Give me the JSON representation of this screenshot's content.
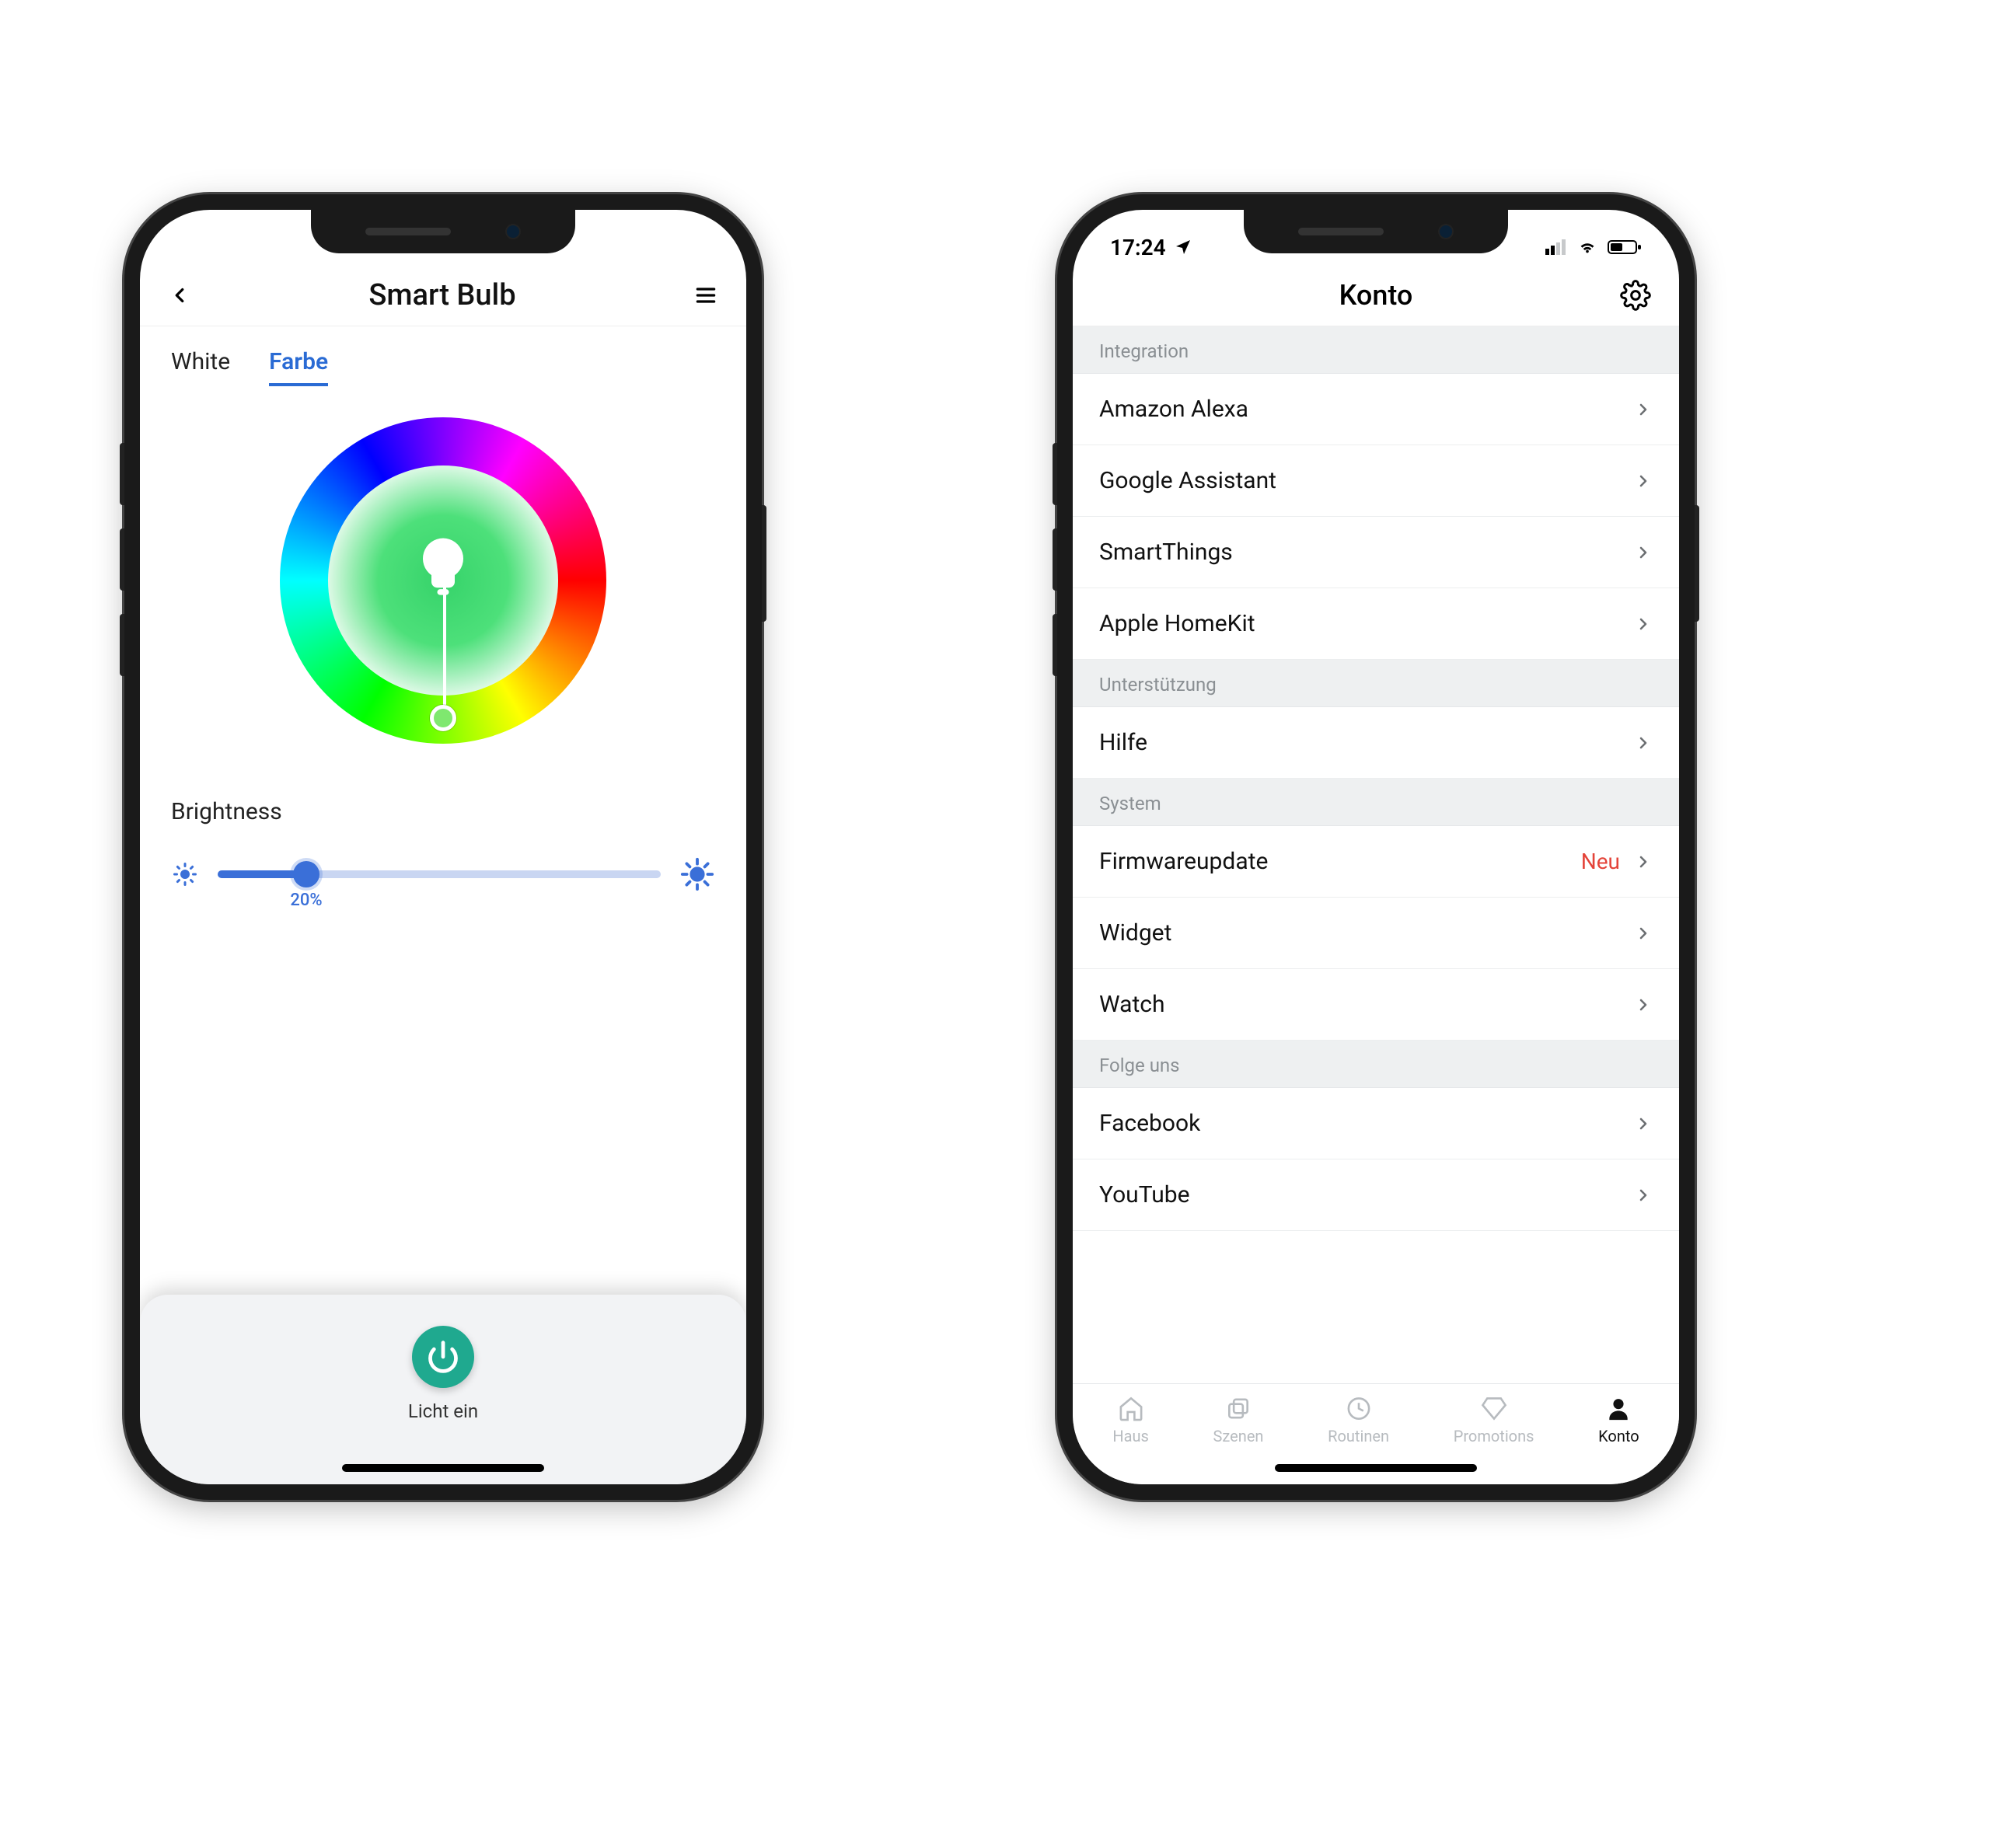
{
  "left": {
    "header_title": "Smart Bulb",
    "tabs": {
      "white": "White",
      "color": "Farbe"
    },
    "brightness_label": "Brightness",
    "brightness_value": "20%",
    "brightness_percent": 20,
    "power_label": "Licht ein"
  },
  "right": {
    "status_time": "17:24",
    "header_title": "Konto",
    "sections": [
      {
        "title": "Integration",
        "rows": [
          {
            "label": "Amazon Alexa"
          },
          {
            "label": "Google Assistant"
          },
          {
            "label": "SmartThings"
          },
          {
            "label": "Apple HomeKit"
          }
        ]
      },
      {
        "title": "Unterstützung",
        "rows": [
          {
            "label": "Hilfe"
          }
        ]
      },
      {
        "title": "System",
        "rows": [
          {
            "label": "Firmwareupdate",
            "badge": "Neu"
          },
          {
            "label": "Widget"
          },
          {
            "label": "Watch"
          }
        ]
      },
      {
        "title": "Folge uns",
        "rows": [
          {
            "label": "Facebook"
          },
          {
            "label": "YouTube"
          }
        ]
      }
    ],
    "tabs": {
      "haus": "Haus",
      "szenen": "Szenen",
      "routinen": "Routinen",
      "promotions": "Promotions",
      "konto": "Konto"
    }
  }
}
